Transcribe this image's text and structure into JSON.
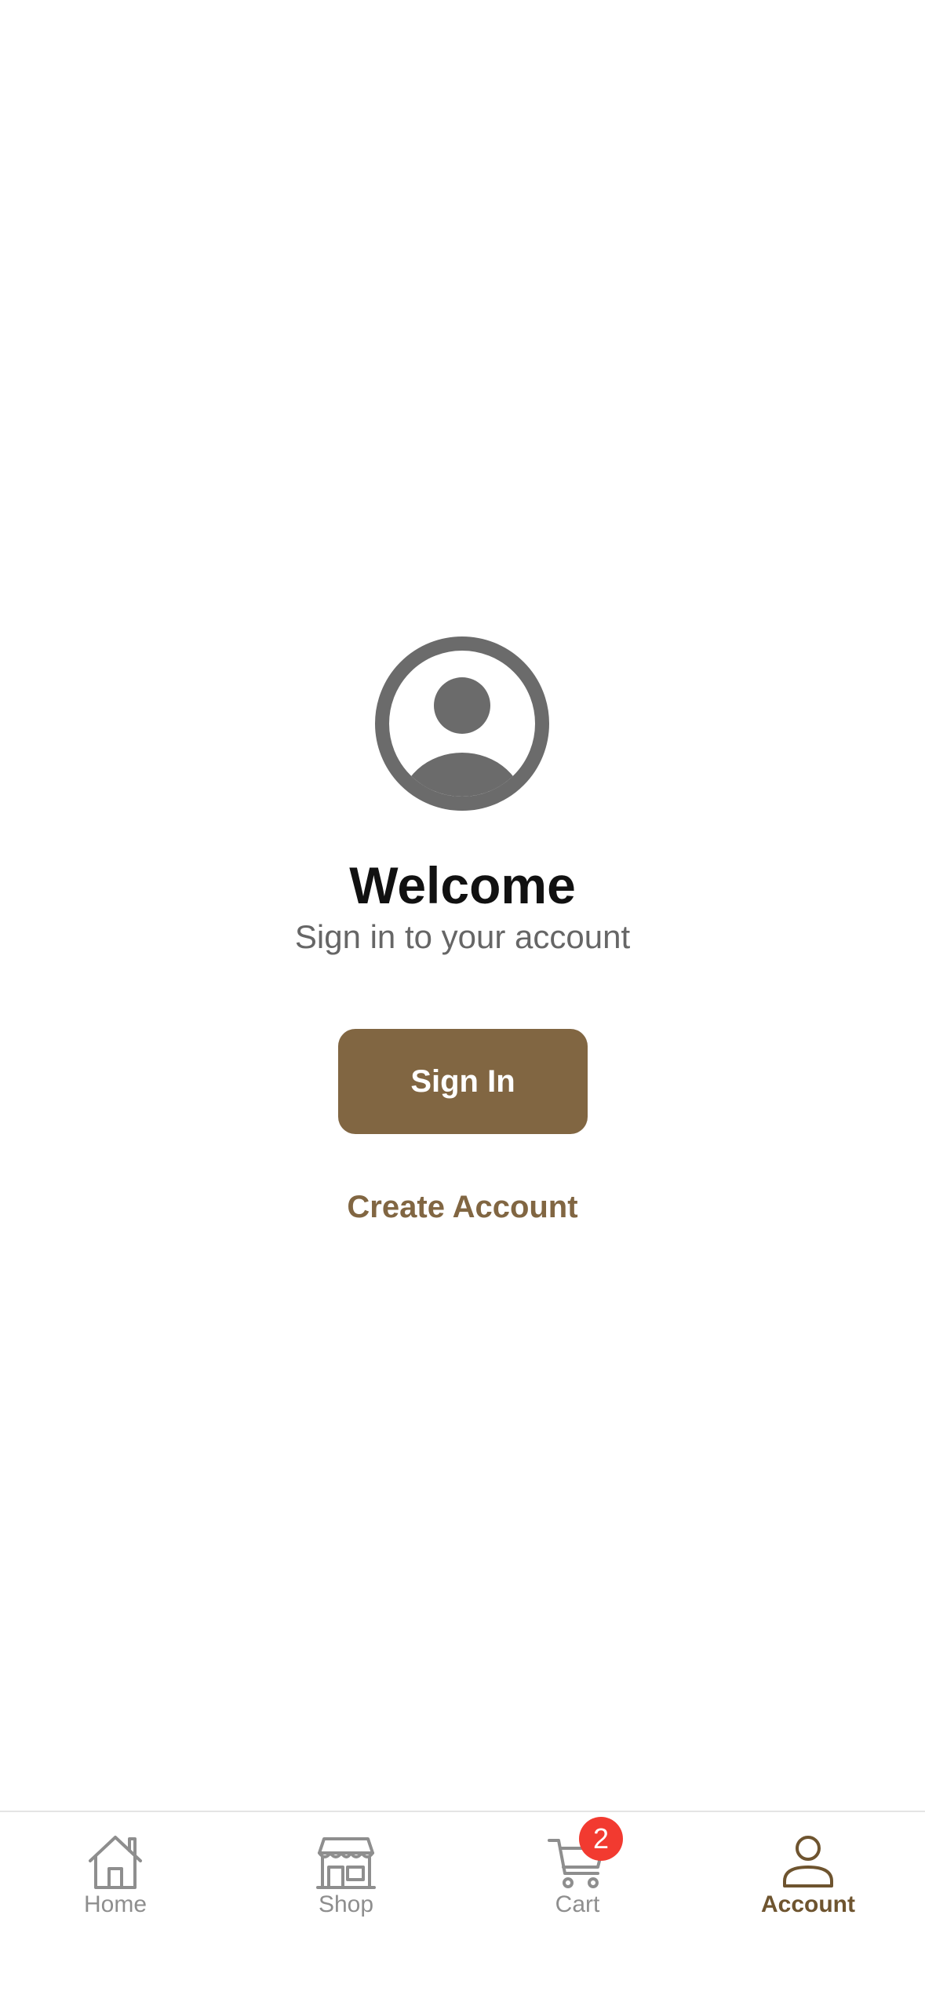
{
  "welcome": {
    "title": "Welcome",
    "subtitle": "Sign in to your account",
    "avatar_icon": "person-circle-icon"
  },
  "actions": {
    "sign_in_label": "Sign In",
    "create_account_label": "Create Account"
  },
  "tab_bar": {
    "active": "Account",
    "items": [
      {
        "label": "Home",
        "icon": "house-icon"
      },
      {
        "label": "Shop",
        "icon": "storefront-icon"
      },
      {
        "label": "Cart",
        "icon": "cart-icon",
        "badge": "2"
      },
      {
        "label": "Account",
        "icon": "person-icon"
      }
    ]
  },
  "colors": {
    "accent": "#816642",
    "badge": "#f23a30",
    "icon_gray": "#6b6b6b",
    "tab_inactive": "#8e8e8e"
  }
}
